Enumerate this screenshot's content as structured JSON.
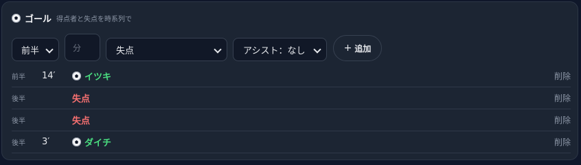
{
  "header": {
    "title": "ゴール",
    "subtitle": "得点者と失点を時系列で"
  },
  "form": {
    "half_value": "前半",
    "minute_placeholder": "分",
    "kind_value": "失点",
    "assist_value": "アシスト：なし",
    "add_label": "追加",
    "add_icon": "+"
  },
  "rows": [
    {
      "half": "前半",
      "minute": "14′",
      "event": "イツキ",
      "type": "goal",
      "delete": "削除"
    },
    {
      "half": "後半",
      "minute": "",
      "event": "失点",
      "type": "conceded",
      "delete": "削除"
    },
    {
      "half": "後半",
      "minute": "",
      "event": "失点",
      "type": "conceded",
      "delete": "削除"
    },
    {
      "half": "後半",
      "minute": "3′",
      "event": "ダイチ",
      "type": "goal",
      "delete": "削除"
    }
  ],
  "colors": {
    "goal": "#4ade80",
    "conceded": "#f87171",
    "panel": "#1c2533"
  }
}
